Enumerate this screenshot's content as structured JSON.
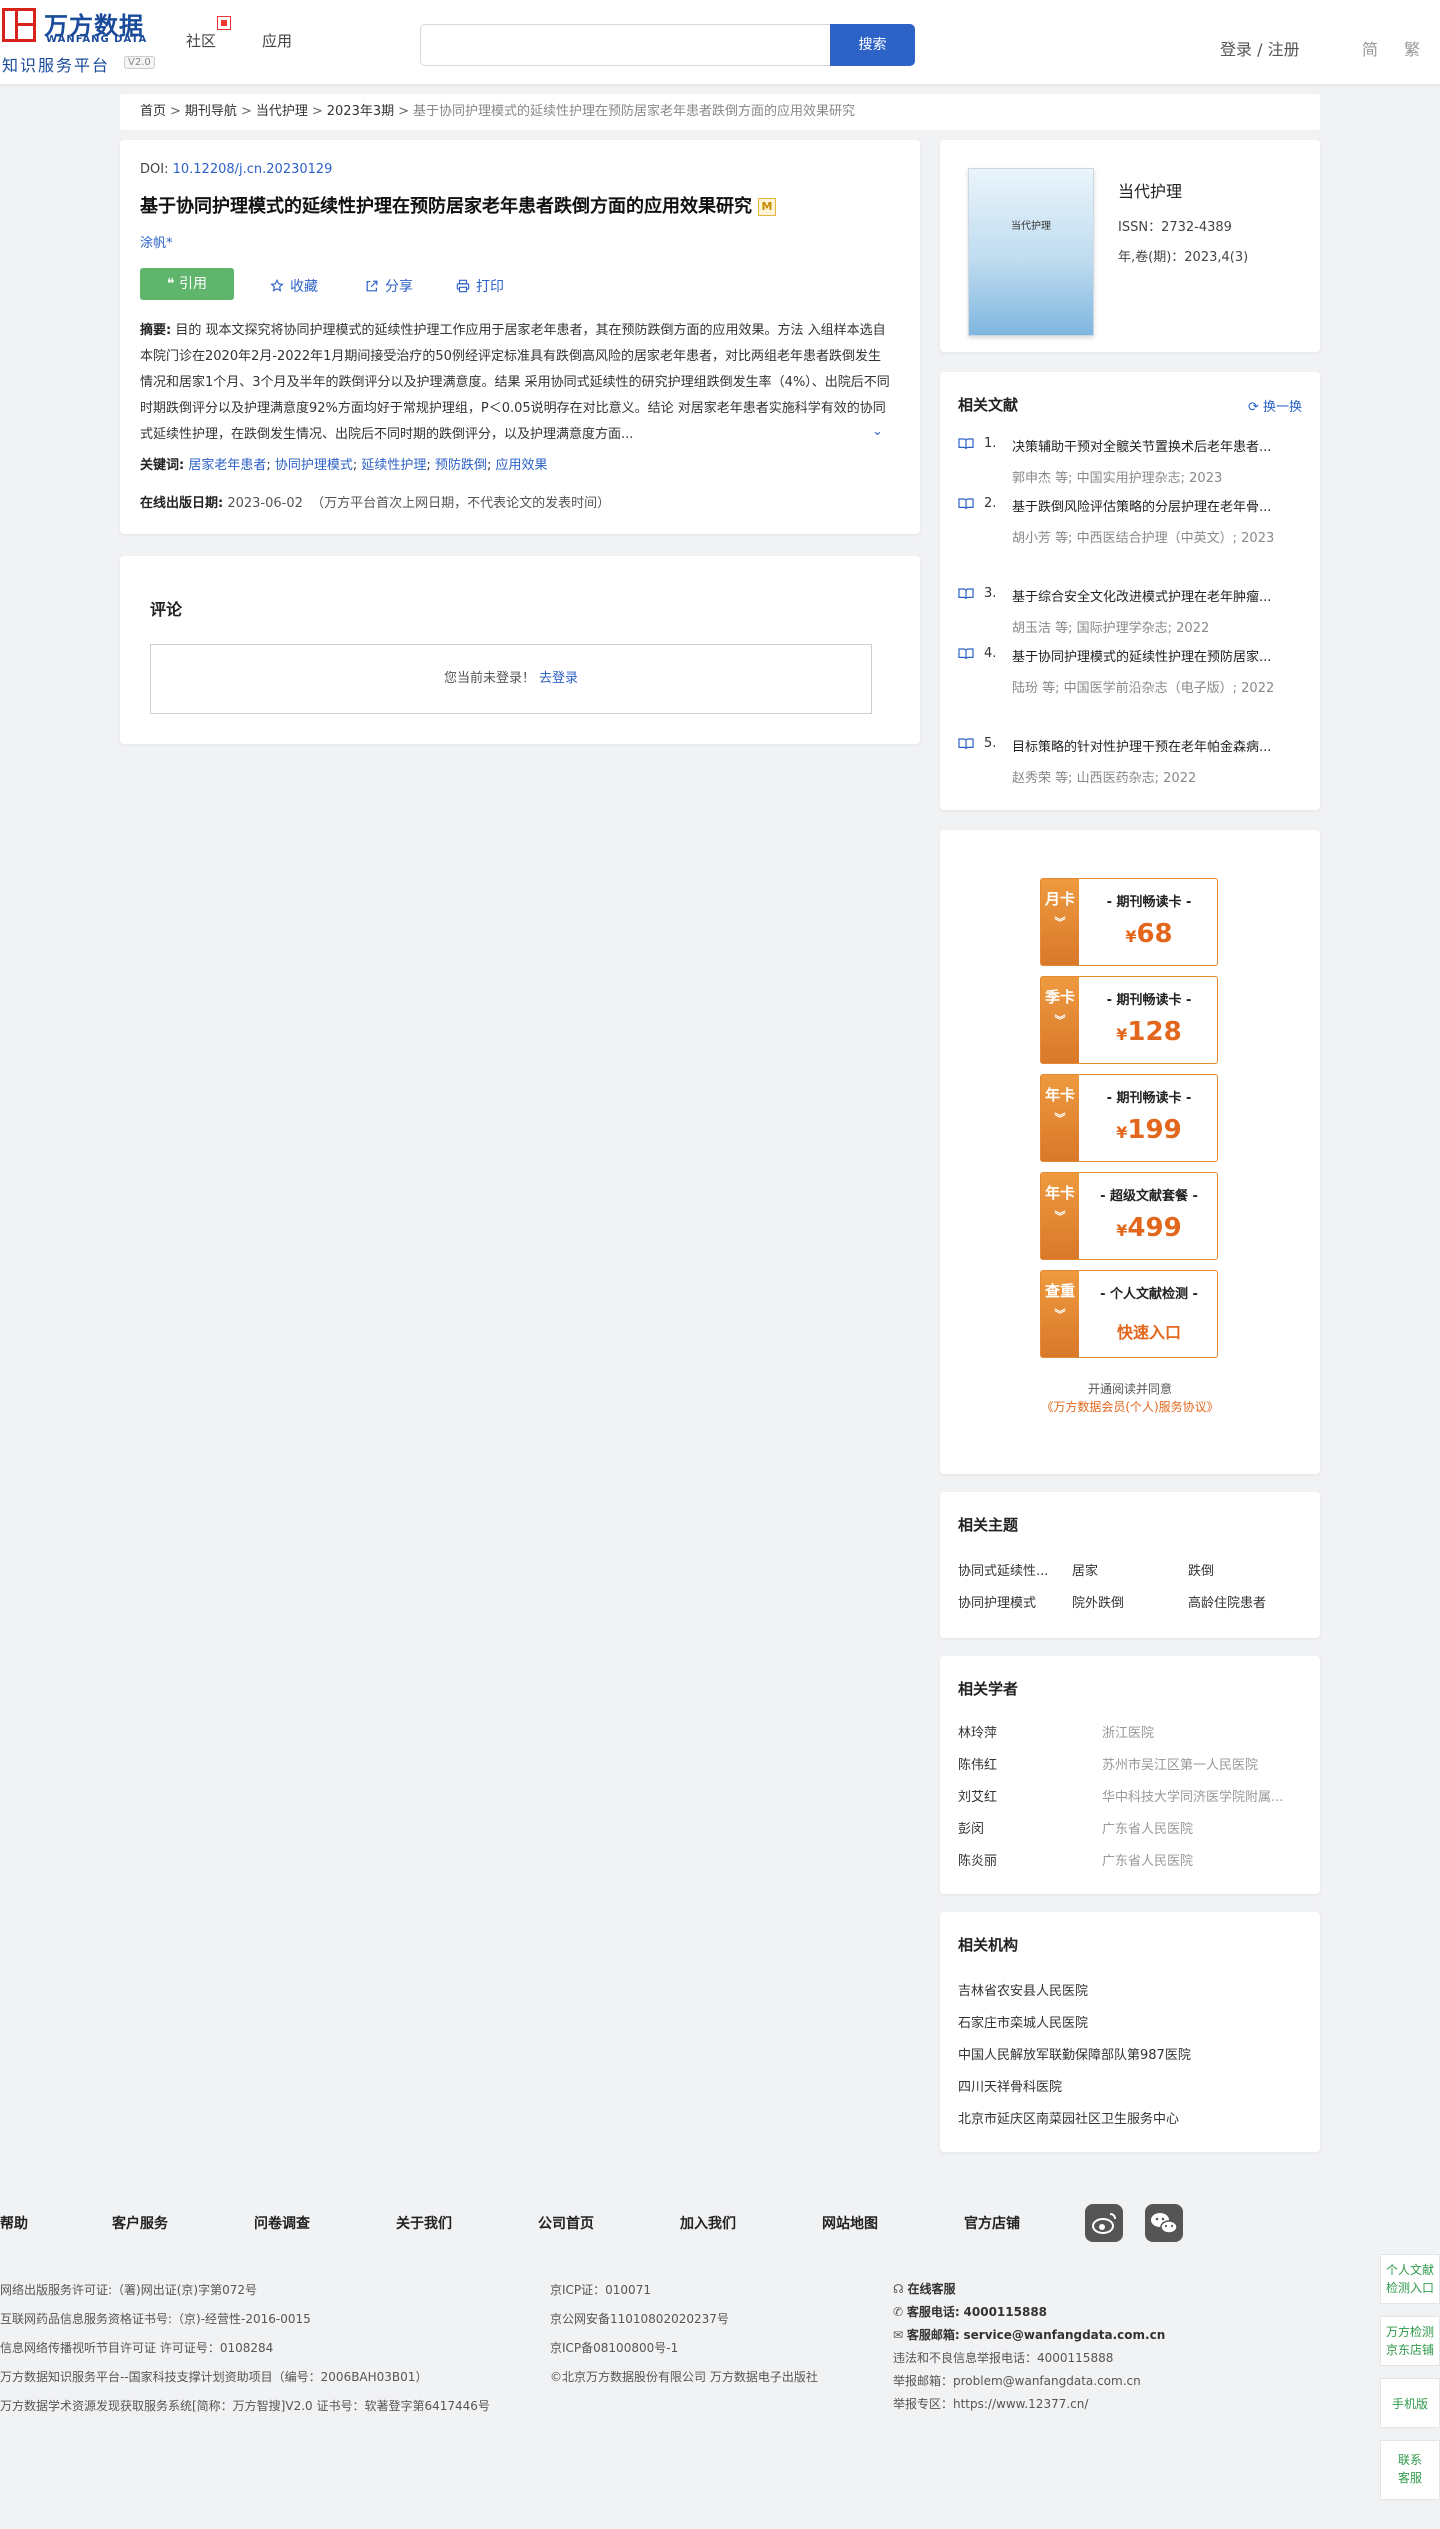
{
  "header": {
    "logo_cn": "万方数据",
    "logo_en": "WANFANG DATA",
    "logo_sub": "知识服务平台",
    "logo_version": "V2.0",
    "nav_community": "社区",
    "nav_apps": "应用",
    "search_placeholder": "",
    "search_button": "搜索",
    "login": "登录 / 注册",
    "lang_simplified": "简",
    "lang_traditional": "繁"
  },
  "breadcrumb": {
    "items": [
      "首页",
      "期刊导航",
      "当代护理",
      "2023年3期"
    ],
    "current": "基于协同护理模式的延续性护理在预防居家老年患者跌倒方面的应用效果研究"
  },
  "article": {
    "doi_label": "DOI:",
    "doi": "10.12208/j.cn.20230129",
    "title": "基于协同护理模式的延续性护理在预防居家老年患者跌倒方面的应用效果研究",
    "badge": "M",
    "author": "涂帆*",
    "actions": {
      "cite": "引用",
      "favorite": "收藏",
      "share": "分享",
      "print": "打印"
    },
    "abstract_label": "摘要:",
    "abstract": "目的 现本文探究将协同护理模式的延续性护理工作应用于居家老年患者，其在预防跌倒方面的应用效果。方法 入组样本选自本院门诊在2020年2月-2022年1月期间接受治疗的50例经评定标准具有跌倒高风险的居家老年患者，对比两组老年患者跌倒发生情况和居家1个月、3个月及半年的跌倒评分以及护理满意度。结果 采用协同式延续性的研究护理组跌倒发生率（4%）、出院后不同时期跌倒评分以及护理满意度92%方面均好于常规护理组，P＜0.05说明存在对比意义。结论 对居家老年患者实施科学有效的协同式延续性护理，在跌倒发生情况、出院后不同时期的跌倒评分，以及护理满意度方面...",
    "keywords_label": "关键词:",
    "keywords": [
      "居家老年患者",
      "协同护理模式",
      "延续性护理",
      "预防跌倒",
      "应用效果"
    ],
    "online_date_label": "在线出版日期:",
    "online_date": "2023-06-02",
    "online_date_note": "（万方平台首次上网日期，不代表论文的发表时间）"
  },
  "comments": {
    "title": "评论",
    "not_logged_in": "您当前未登录！",
    "login_link": "去登录"
  },
  "journal": {
    "cover_text": "当代护理",
    "name": "当代护理",
    "issn": "ISSN：2732-4389",
    "volume": "年,卷(期)：2023,4(3)"
  },
  "related_docs": {
    "title": "相关文献",
    "refresh": "换一换",
    "items": [
      {
        "num": "1.",
        "title": "决策辅助干预对全髋关节置换术后老年患者...",
        "meta": "郭申杰  等; 中国实用护理杂志; 2023"
      },
      {
        "num": "2.",
        "title": "基于跌倒风险评估策略的分层护理在老年骨...",
        "meta": "胡小芳  等; 中西医结合护理（中英文）; 2023"
      },
      {
        "num": "3.",
        "title": "基于综合安全文化改进模式护理在老年肿瘤...",
        "meta": "胡玉洁  等; 国际护理学杂志; 2022"
      },
      {
        "num": "4.",
        "title": "基于协同护理模式的延续性护理在预防居家...",
        "meta": "陆玢  等; 中国医学前沿杂志（电子版）; 2022"
      },
      {
        "num": "5.",
        "title": "目标策略的针对性护理干预在老年帕金森病...",
        "meta": "赵秀荣  等; 山西医药杂志; 2022"
      }
    ]
  },
  "promos": {
    "items": [
      {
        "tag": "月卡",
        "title": "- 期刊畅读卡 -",
        "currency": "¥",
        "price": "68"
      },
      {
        "tag": "季卡",
        "title": "- 期刊畅读卡 -",
        "currency": "¥",
        "price": "128"
      },
      {
        "tag": "年卡",
        "title": "- 期刊畅读卡 -",
        "currency": "¥",
        "price": "199"
      },
      {
        "tag": "年卡",
        "title": "- 超级文献套餐 -",
        "currency": "¥",
        "price": "499"
      },
      {
        "tag": "查重",
        "title": "- 个人文献检测 -",
        "link": "快速入口"
      }
    ],
    "agree_text": "开通阅读并同意",
    "agree_link": "《万方数据会员(个人)服务协议》"
  },
  "related_topics": {
    "title": "相关主题",
    "items": [
      "协同式延续性...",
      "居家",
      "跌倒",
      "协同护理模式",
      "院外跌倒",
      "高龄住院患者"
    ]
  },
  "related_scholars": {
    "title": "相关学者",
    "items": [
      {
        "name": "林玲萍",
        "org": "浙江医院"
      },
      {
        "name": "陈伟红",
        "org": "苏州市吴江区第一人民医院"
      },
      {
        "name": "刘艾红",
        "org": "华中科技大学同济医学院附属..."
      },
      {
        "name": "彭闵",
        "org": "广东省人民医院"
      },
      {
        "name": "陈炎丽",
        "org": "广东省人民医院"
      }
    ]
  },
  "related_orgs": {
    "title": "相关机构",
    "items": [
      "吉林省农安县人民医院",
      "石家庄市栾城人民医院",
      "中国人民解放军联勤保障部队第987医院",
      "四川天祥骨科医院",
      "北京市延庆区南菜园社区卫生服务中心"
    ]
  },
  "footer": {
    "nav": [
      "帮助",
      "客户服务",
      "问卷调查",
      "关于我们",
      "公司首页",
      "加入我们",
      "网站地图",
      "官方店铺"
    ],
    "col1": [
      "网络出版服务许可证:（署)网出证(京)字第072号",
      "互联网药品信息服务资格证书号:（京)-经营性-2016-0015",
      "信息网络传播视听节目许可证 许可证号：0108284",
      "万方数据知识服务平台--国家科技支撑计划资助项目（编号：2006BAH03B01）",
      "万方数据学术资源发现获取服务系统[简称：万方智搜]V2.0 证书号：软著登字第6417446号"
    ],
    "col2": [
      "京ICP证：010071",
      "京公网安备11010802020237号",
      "京ICP备08100800号-1",
      "©北京万方数据股份有限公司 万方数据电子出版社"
    ],
    "online_service": "在线客服",
    "phone_label": "客服电话:",
    "phone": "4000115888",
    "email_label": "客服邮箱:",
    "email": "service@wanfangdata.com.cn",
    "report_phone": "违法和不良信息举报电话：4000115888",
    "report_email": "举报邮箱：problem@wanfangdata.com.cn",
    "report_site": "举报专区：https://www.12377.cn/"
  },
  "float": {
    "personal_check": "个人文献检测入口",
    "jd_store": "万方检测京东店铺",
    "mobile": "手机版",
    "contact": "联系客服"
  }
}
